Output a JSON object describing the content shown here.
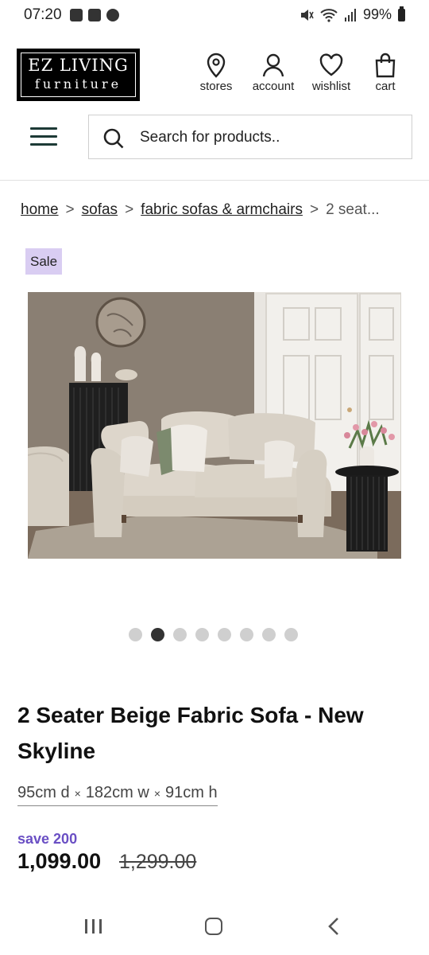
{
  "status_bar": {
    "time": "07:20",
    "battery": "99%"
  },
  "header": {
    "logo_line1": "EZ LIVING",
    "logo_line2": "furniture",
    "nav": [
      {
        "label": "stores",
        "icon": "location-pin-icon"
      },
      {
        "label": "account",
        "icon": "user-icon"
      },
      {
        "label": "wishlist",
        "icon": "heart-icon"
      },
      {
        "label": "cart",
        "icon": "shopping-bag-icon"
      }
    ]
  },
  "search": {
    "placeholder": "Search for products.."
  },
  "breadcrumb": {
    "items": [
      "home",
      "sofas",
      "fabric sofas & armchairs"
    ],
    "separator": ">",
    "current": "2 seat..."
  },
  "product": {
    "badge": "Sale",
    "title": "2 Seater Beige Fabric Sofa - New Skyline",
    "dims": {
      "depth": "95cm d",
      "width": "182cm w",
      "height": "91cm h",
      "sep": "×"
    },
    "save_label": "save 200",
    "price": "1,099.00",
    "old_price": "1,299.00",
    "gallery": {
      "count": 8,
      "active_index": 1
    }
  },
  "colors": {
    "sale_badge": "#d9cdf2",
    "save_text": "#6a4fc4",
    "menu_icon": "#1d3a36"
  }
}
